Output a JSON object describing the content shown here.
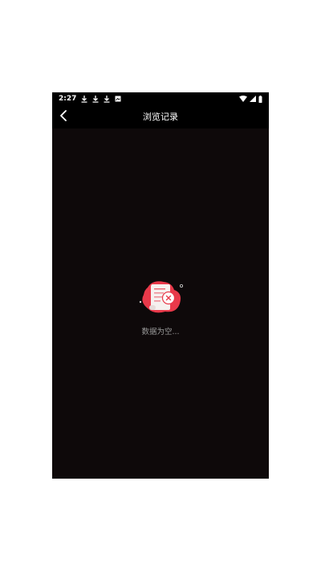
{
  "status_bar": {
    "time": "2:27",
    "notification_icons": [
      "download-icon",
      "download-icon",
      "download-icon",
      "image-icon"
    ],
    "system_icons": [
      "wifi-icon",
      "signal-icon",
      "battery-icon"
    ]
  },
  "header": {
    "title": "浏览记录",
    "back_icon": "chevron-left-icon"
  },
  "empty_state": {
    "message": "数据为空...",
    "illustration": "empty-document-icon",
    "accent_color": "#e8394a"
  },
  "colors": {
    "background": "#0e090a",
    "header_background": "#000000",
    "text_primary": "#ffffff",
    "text_secondary": "#9a9a9a"
  }
}
